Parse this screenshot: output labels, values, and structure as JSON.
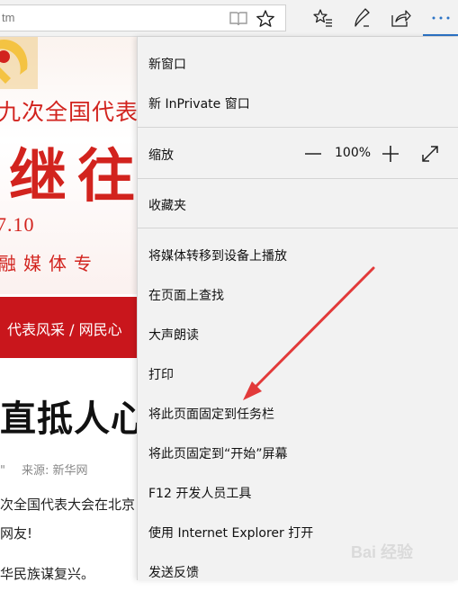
{
  "browser": {
    "url_text": "tm",
    "icons": [
      "reading-view-icon",
      "favorite-star-icon",
      "hub-icon",
      "web-notes-icon",
      "share-icon",
      "more-icon"
    ],
    "accent_color": "#2b73c6"
  },
  "page": {
    "banner_line1": "九次全国代表",
    "banner_big": "继往",
    "banner_date": "7.10",
    "banner_line3": "融媒体专",
    "nav_text": "代表风采  /  网民心",
    "article_title": "直抵人心",
    "meta_dash": "\"",
    "meta_source": "来源:  新华网",
    "para1": "次全国代表大会在北京",
    "para2": "网友!",
    "para3": "华民族谋复兴。",
    "brand_color": "#c9161c"
  },
  "menu": {
    "new_window": "新窗口",
    "new_inprivate": "新 InPrivate 窗口",
    "zoom_label": "缩放",
    "zoom_value": "100%",
    "favorites": "收藏夹",
    "cast_media": "将媒体转移到设备上播放",
    "find_on_page": "在页面上查找",
    "read_aloud": "大声朗读",
    "print": "打印",
    "pin_taskbar": "将此页面固定到任务栏",
    "pin_start": "将此页固定到“开始”屏幕",
    "dev_tools": "F12 开发人员工具",
    "open_ie": "使用 Internet Explorer 打开",
    "send_feedback": "发送反馈"
  },
  "watermark": {
    "text": "Bai 经验"
  }
}
